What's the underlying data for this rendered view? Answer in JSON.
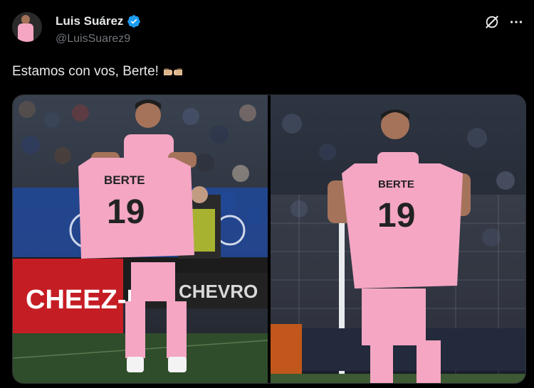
{
  "author": {
    "name": "Luis Suárez",
    "handle": "@LuisSuarez9",
    "verified": true,
    "verified_color": "#1d9bf0"
  },
  "header_icons": [
    "grok-icon",
    "more-icon"
  ],
  "tweet": {
    "text": "Estamos con vos, Berte!",
    "emoji": "fist-bump-emoji"
  },
  "media": {
    "left_photo": {
      "jersey_name": "BERTE",
      "jersey_number": "19",
      "ad_board_left": "CHEEZ-IT",
      "ad_board_right": "CHEVRO"
    },
    "right_photo": {
      "jersey_name": "BERTE",
      "jersey_number": "19"
    }
  },
  "colors": {
    "background": "#000000",
    "jersey_pink": "#f4a6c3",
    "text_primary": "#e7e9ea",
    "text_secondary": "#71767b"
  }
}
